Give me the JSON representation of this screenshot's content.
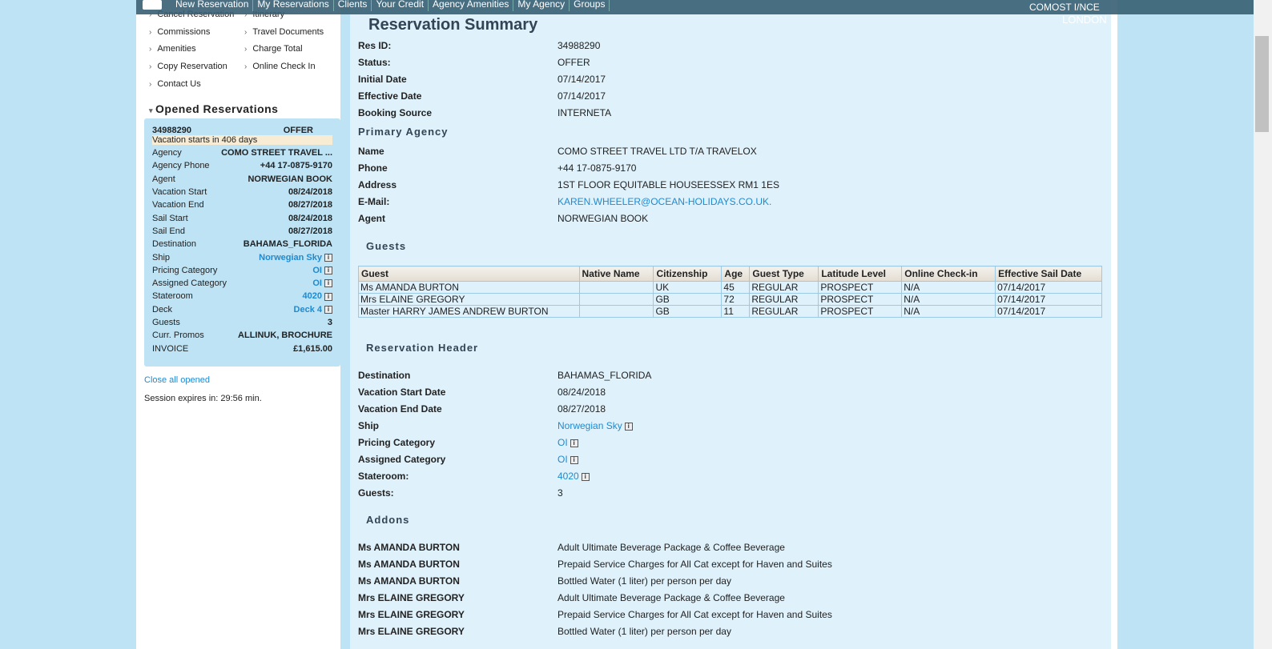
{
  "nav": {
    "items": [
      "New Reservation",
      "My Reservations",
      "Clients",
      "Your Credit",
      "Agency Amenities",
      "My Agency",
      "Groups"
    ],
    "user": "COMOST I/NCE",
    "city": "LONDON"
  },
  "page_title": "Reservation Summary",
  "menu": {
    "col1": [
      "Cancel Reservation",
      "Commissions",
      "Amenities",
      "Copy Reservation",
      "Contact Us"
    ],
    "col2": [
      "Itinerary",
      "Travel Documents",
      "Charge Total",
      "Online Check In"
    ]
  },
  "opened": {
    "heading": "Opened Reservations",
    "res_id": "34988290",
    "status": "OFFER",
    "note": "Vacation starts in 406 days",
    "rows": [
      {
        "k": "Agency",
        "v": "COMO STREET TRAVEL ..."
      },
      {
        "k": "Agency Phone",
        "v": "+44 17-0875-9170"
      },
      {
        "k": "Agent",
        "v": "NORWEGIAN BOOK"
      },
      {
        "k": "Vacation Start",
        "v": "08/24/2018"
      },
      {
        "k": "Vacation End",
        "v": "08/27/2018"
      },
      {
        "k": "Sail Start",
        "v": "08/24/2018"
      },
      {
        "k": "Sail End",
        "v": "08/27/2018"
      },
      {
        "k": "Destination",
        "v": "BAHAMAS_FLORIDA"
      },
      {
        "k": "Ship",
        "v": "Norwegian Sky",
        "link": true
      },
      {
        "k": "Pricing Category",
        "v": "OI",
        "link": true
      },
      {
        "k": "Assigned Category",
        "v": "OI",
        "link": true
      },
      {
        "k": "Stateroom",
        "v": "4020",
        "link": true
      },
      {
        "k": "Deck",
        "v": "Deck 4",
        "link": true
      },
      {
        "k": "Guests",
        "v": "3"
      },
      {
        "k": "Curr. Promos",
        "v": "ALLINUK, BROCHURE"
      },
      {
        "k": "INVOICE",
        "v": "£1,615.00"
      }
    ],
    "close_all": "Close all opened",
    "session": "Session expires in: 29:56 min."
  },
  "summary": [
    {
      "k": "Res ID:",
      "v": "34988290"
    },
    {
      "k": "Status:",
      "v": "OFFER"
    },
    {
      "k": "Initial Date",
      "v": "07/14/2017"
    },
    {
      "k": "Effective Date",
      "v": "07/14/2017"
    },
    {
      "k": "Booking Source",
      "v": "INTERNETA"
    }
  ],
  "primary_agency": {
    "heading": "Primary Agency",
    "rows": [
      {
        "k": "Name",
        "v": "COMO STREET TRAVEL LTD T/A TRAVELOX"
      },
      {
        "k": "Phone",
        "v": "+44 17-0875-9170"
      },
      {
        "k": "Address",
        "v": "1ST FLOOR EQUITABLE HOUSEESSEX RM1 1ES"
      },
      {
        "k": "E-Mail:",
        "v": "KAREN.WHEELER@OCEAN-HOLIDAYS.CO.UK.",
        "link": true
      },
      {
        "k": "Agent",
        "v": "NORWEGIAN BOOK"
      }
    ]
  },
  "guests": {
    "heading": "Guests",
    "columns": [
      "Guest",
      "Native Name",
      "Citizenship",
      "Age",
      "Guest Type",
      "Latitude Level",
      "Online Check-in",
      "Effective Sail Date"
    ],
    "rows": [
      [
        "Ms AMANDA BURTON",
        "",
        "UK",
        "45",
        "REGULAR",
        "PROSPECT",
        "N/A",
        "07/14/2017"
      ],
      [
        "Mrs ELAINE GREGORY",
        "",
        "GB",
        "72",
        "REGULAR",
        "PROSPECT",
        "N/A",
        "07/14/2017"
      ],
      [
        "Master HARRY JAMES ANDREW BURTON",
        "",
        "GB",
        "11",
        "REGULAR",
        "PROSPECT",
        "N/A",
        "07/14/2017"
      ]
    ]
  },
  "res_header": {
    "heading": "Reservation Header",
    "rows": [
      {
        "k": "Destination",
        "v": "BAHAMAS_FLORIDA"
      },
      {
        "k": "Vacation Start Date",
        "v": "08/24/2018"
      },
      {
        "k": "Vacation End Date",
        "v": "08/27/2018"
      },
      {
        "k": "Ship",
        "v": "Norwegian Sky",
        "link": true,
        "info": true
      },
      {
        "k": "Pricing Category",
        "v": "OI",
        "link": true,
        "info": true
      },
      {
        "k": "Assigned Category",
        "v": "OI",
        "link": true,
        "info": true
      },
      {
        "k": "Stateroom:",
        "v": "4020",
        "link": true,
        "info": true
      },
      {
        "k": "Guests:",
        "v": "3"
      }
    ]
  },
  "addons": {
    "heading": "Addons",
    "rows": [
      {
        "k": "Ms AMANDA BURTON",
        "v": "Adult Ultimate Beverage Package & Coffee Beverage"
      },
      {
        "k": "Ms AMANDA BURTON",
        "v": "Prepaid Service Charges for All Cat except for Haven and Suites"
      },
      {
        "k": "Ms AMANDA BURTON",
        "v": "Bottled Water (1 liter) per person per day"
      },
      {
        "k": "Mrs ELAINE GREGORY",
        "v": "Adult Ultimate Beverage Package & Coffee Beverage"
      },
      {
        "k": "Mrs ELAINE GREGORY",
        "v": "Prepaid Service Charges for All Cat except for Haven and Suites"
      },
      {
        "k": "Mrs ELAINE GREGORY",
        "v": "Bottled Water (1 liter) per person per day"
      }
    ]
  }
}
